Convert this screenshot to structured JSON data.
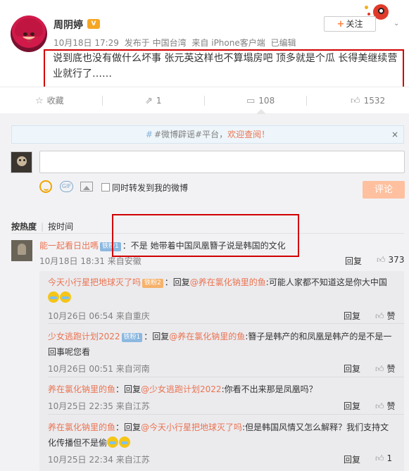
{
  "post": {
    "username": "周阴婷",
    "vip_badge": "V",
    "date": "10月18日 17:29",
    "source_location": "发布于 中国台湾",
    "source_device": "来自 iPhone客户端",
    "edited": "已编辑",
    "follow_label": "关注",
    "text": "说到底也没有做什么坏事 张元英这样也不算塌房吧 顶多就是个瓜 长得美继续营业就行了……"
  },
  "actions": {
    "favorite": "收藏",
    "forward_count": "1",
    "comment_count": "108",
    "like_count": "1532"
  },
  "notice": {
    "prefix": "#微博辟谣#平台，",
    "link": "欢迎查阅！",
    "close": "×"
  },
  "composer": {
    "gif_label": "GIF",
    "forward_checkbox_label": "同时转发到我的微博",
    "submit_label": "评论"
  },
  "sort": {
    "hot": "按热度",
    "time": "按时间"
  },
  "main_comment": {
    "user": "能一起看日出嗎",
    "badge": "铁粉1",
    "text": "：不是 她带着中国凤凰簪子说是韩国的文化",
    "meta": "10月18日 18:31  来自安徽",
    "reply": "回复",
    "likes": "373"
  },
  "sub_replies": [
    {
      "user": "今天小行星把地球灭了吗",
      "badge": "铁粉2",
      "reply_prefix": "：回复",
      "reply_to": "@养在氯化钠里的鱼",
      "text": ":可能人家都不知道这是你大中国",
      "meta": "10月26日 06:54  来自重庆",
      "reply": "回复",
      "like": "赞"
    },
    {
      "user": "少女逃跑计划2022",
      "badge": "铁粉1",
      "reply_prefix": "：回复",
      "reply_to": "@养在氯化钠里的鱼",
      "text": ":簪子是韩产的和凤凰是韩产的是不是一回事呢您看",
      "meta": "10月26日 00:51  来自河南",
      "reply": "回复",
      "like": "赞"
    },
    {
      "user": "养在氯化钠里的鱼",
      "reply_prefix": "：回复",
      "reply_to": "@少女逃跑计划2022",
      "text": ":你看不出来那是凤凰吗？",
      "meta": "10月25日 22:35  来自江苏",
      "reply": "回复",
      "like": "赞"
    },
    {
      "user": "养在氯化钠里的鱼",
      "reply_prefix": "：回复",
      "reply_to": "@今天小行星把地球灭了吗",
      "text": ":但是韩国风情又怎么解释？我们支持文化传播但不是偷",
      "meta": "10月25日 22:34  来自江苏",
      "reply": "回复",
      "likes": "1"
    }
  ],
  "colors": {
    "accent": "#eb7350",
    "highlight_box": "#d20000",
    "submit_disabled": "#ffc09f"
  }
}
